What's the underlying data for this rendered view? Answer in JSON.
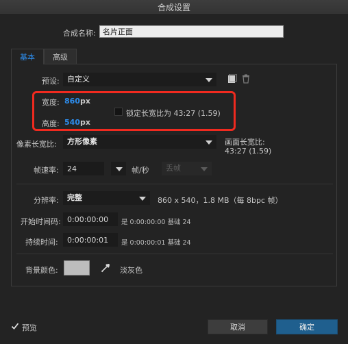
{
  "window": {
    "title": "合成设置"
  },
  "comp_name": {
    "label": "合成名称:",
    "value": "名片正面"
  },
  "tabs": [
    {
      "label": "基本"
    },
    {
      "label": "高级"
    }
  ],
  "preset": {
    "label": "预设:",
    "value": "自定义"
  },
  "width": {
    "label": "宽度:",
    "value": "860",
    "unit": "px"
  },
  "height": {
    "label": "高度:",
    "value": "540",
    "unit": "px"
  },
  "lock_aspect": {
    "label": "锁定长宽比为 43:27 (1.59)",
    "checked": false
  },
  "pixel_aspect": {
    "label": "像素长宽比:",
    "value": "方形像素"
  },
  "frame_aspect": {
    "label": "画面长宽比:",
    "value": "43:27 (1.59)"
  },
  "frame_rate": {
    "label": "帧速率:",
    "value": "24",
    "unit": "帧/秒",
    "drop_frame": "丢帧"
  },
  "resolution": {
    "label": "分辨率:",
    "value": "完整",
    "info": "860 x 540，1.8 MB（每 8bpc 帧）"
  },
  "start_timecode": {
    "label": "开始时间码:",
    "value": "0:00:00:00",
    "info": "是 0:00:00:00 基础 24"
  },
  "duration": {
    "label": "持续时间:",
    "value": "0:00:00:01",
    "info": "是 0:00:00:01 基础 24"
  },
  "background": {
    "label": "背景颜色:",
    "color": "#bdbdbd",
    "name": "淡灰色"
  },
  "footer": {
    "preview_label": "预览",
    "preview_checked": true,
    "cancel_label": "取消",
    "ok_label": "确定"
  },
  "colors": {
    "accent": "#2d8ceb",
    "highlight_box": "#f02a1f",
    "ok_button": "#1f5f8e"
  }
}
